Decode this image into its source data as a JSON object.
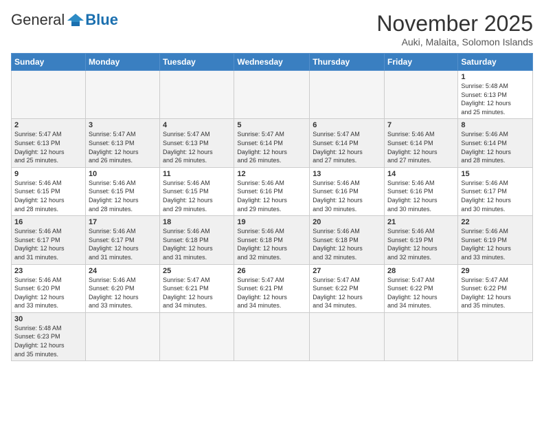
{
  "header": {
    "logo_general": "General",
    "logo_blue": "Blue",
    "month_title": "November 2025",
    "subtitle": "Auki, Malaita, Solomon Islands"
  },
  "weekdays": [
    "Sunday",
    "Monday",
    "Tuesday",
    "Wednesday",
    "Thursday",
    "Friday",
    "Saturday"
  ],
  "weeks": [
    [
      {
        "day": "",
        "info": ""
      },
      {
        "day": "",
        "info": ""
      },
      {
        "day": "",
        "info": ""
      },
      {
        "day": "",
        "info": ""
      },
      {
        "day": "",
        "info": ""
      },
      {
        "day": "",
        "info": ""
      },
      {
        "day": "1",
        "info": "Sunrise: 5:48 AM\nSunset: 6:13 PM\nDaylight: 12 hours\nand 25 minutes."
      }
    ],
    [
      {
        "day": "2",
        "info": "Sunrise: 5:47 AM\nSunset: 6:13 PM\nDaylight: 12 hours\nand 25 minutes."
      },
      {
        "day": "3",
        "info": "Sunrise: 5:47 AM\nSunset: 6:13 PM\nDaylight: 12 hours\nand 26 minutes."
      },
      {
        "day": "4",
        "info": "Sunrise: 5:47 AM\nSunset: 6:13 PM\nDaylight: 12 hours\nand 26 minutes."
      },
      {
        "day": "5",
        "info": "Sunrise: 5:47 AM\nSunset: 6:14 PM\nDaylight: 12 hours\nand 26 minutes."
      },
      {
        "day": "6",
        "info": "Sunrise: 5:47 AM\nSunset: 6:14 PM\nDaylight: 12 hours\nand 27 minutes."
      },
      {
        "day": "7",
        "info": "Sunrise: 5:46 AM\nSunset: 6:14 PM\nDaylight: 12 hours\nand 27 minutes."
      },
      {
        "day": "8",
        "info": "Sunrise: 5:46 AM\nSunset: 6:14 PM\nDaylight: 12 hours\nand 28 minutes."
      }
    ],
    [
      {
        "day": "9",
        "info": "Sunrise: 5:46 AM\nSunset: 6:15 PM\nDaylight: 12 hours\nand 28 minutes."
      },
      {
        "day": "10",
        "info": "Sunrise: 5:46 AM\nSunset: 6:15 PM\nDaylight: 12 hours\nand 28 minutes."
      },
      {
        "day": "11",
        "info": "Sunrise: 5:46 AM\nSunset: 6:15 PM\nDaylight: 12 hours\nand 29 minutes."
      },
      {
        "day": "12",
        "info": "Sunrise: 5:46 AM\nSunset: 6:16 PM\nDaylight: 12 hours\nand 29 minutes."
      },
      {
        "day": "13",
        "info": "Sunrise: 5:46 AM\nSunset: 6:16 PM\nDaylight: 12 hours\nand 30 minutes."
      },
      {
        "day": "14",
        "info": "Sunrise: 5:46 AM\nSunset: 6:16 PM\nDaylight: 12 hours\nand 30 minutes."
      },
      {
        "day": "15",
        "info": "Sunrise: 5:46 AM\nSunset: 6:17 PM\nDaylight: 12 hours\nand 30 minutes."
      }
    ],
    [
      {
        "day": "16",
        "info": "Sunrise: 5:46 AM\nSunset: 6:17 PM\nDaylight: 12 hours\nand 31 minutes."
      },
      {
        "day": "17",
        "info": "Sunrise: 5:46 AM\nSunset: 6:17 PM\nDaylight: 12 hours\nand 31 minutes."
      },
      {
        "day": "18",
        "info": "Sunrise: 5:46 AM\nSunset: 6:18 PM\nDaylight: 12 hours\nand 31 minutes."
      },
      {
        "day": "19",
        "info": "Sunrise: 5:46 AM\nSunset: 6:18 PM\nDaylight: 12 hours\nand 32 minutes."
      },
      {
        "day": "20",
        "info": "Sunrise: 5:46 AM\nSunset: 6:18 PM\nDaylight: 12 hours\nand 32 minutes."
      },
      {
        "day": "21",
        "info": "Sunrise: 5:46 AM\nSunset: 6:19 PM\nDaylight: 12 hours\nand 32 minutes."
      },
      {
        "day": "22",
        "info": "Sunrise: 5:46 AM\nSunset: 6:19 PM\nDaylight: 12 hours\nand 33 minutes."
      }
    ],
    [
      {
        "day": "23",
        "info": "Sunrise: 5:46 AM\nSunset: 6:20 PM\nDaylight: 12 hours\nand 33 minutes."
      },
      {
        "day": "24",
        "info": "Sunrise: 5:46 AM\nSunset: 6:20 PM\nDaylight: 12 hours\nand 33 minutes."
      },
      {
        "day": "25",
        "info": "Sunrise: 5:47 AM\nSunset: 6:21 PM\nDaylight: 12 hours\nand 34 minutes."
      },
      {
        "day": "26",
        "info": "Sunrise: 5:47 AM\nSunset: 6:21 PM\nDaylight: 12 hours\nand 34 minutes."
      },
      {
        "day": "27",
        "info": "Sunrise: 5:47 AM\nSunset: 6:22 PM\nDaylight: 12 hours\nand 34 minutes."
      },
      {
        "day": "28",
        "info": "Sunrise: 5:47 AM\nSunset: 6:22 PM\nDaylight: 12 hours\nand 34 minutes."
      },
      {
        "day": "29",
        "info": "Sunrise: 5:47 AM\nSunset: 6:22 PM\nDaylight: 12 hours\nand 35 minutes."
      }
    ],
    [
      {
        "day": "30",
        "info": "Sunrise: 5:48 AM\nSunset: 6:23 PM\nDaylight: 12 hours\nand 35 minutes."
      },
      {
        "day": "",
        "info": ""
      },
      {
        "day": "",
        "info": ""
      },
      {
        "day": "",
        "info": ""
      },
      {
        "day": "",
        "info": ""
      },
      {
        "day": "",
        "info": ""
      },
      {
        "day": "",
        "info": ""
      }
    ]
  ]
}
